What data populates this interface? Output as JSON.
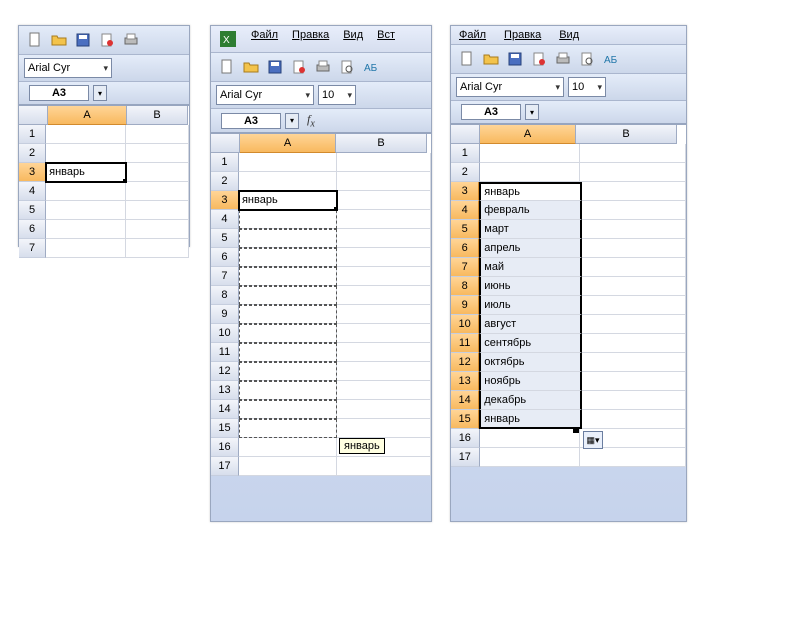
{
  "menus": {
    "file": "Файл",
    "edit": "Правка",
    "view": "Вид",
    "ins": "Вст"
  },
  "font": {
    "name": "Arial Cyr",
    "size": "10"
  },
  "namebox": "A3",
  "columns": {
    "A": "A",
    "B": "B"
  },
  "p1": {
    "rows": [
      1,
      2,
      3,
      4,
      5,
      6,
      7
    ]
  },
  "p2": {
    "rows": [
      1,
      2,
      3,
      4,
      5,
      6,
      7,
      8,
      9,
      10,
      11,
      12,
      13,
      14,
      15,
      16,
      17
    ],
    "tooltip": "январь"
  },
  "p3": {
    "rows": [
      1,
      2,
      3,
      4,
      5,
      6,
      7,
      8,
      9,
      10,
      11,
      12,
      13,
      14,
      15,
      16,
      17
    ]
  },
  "months": {
    "3": "январь",
    "4": "февраль",
    "5": "март",
    "6": "апрель",
    "7": "май",
    "8": "июнь",
    "9": "июль",
    "10": "август",
    "11": "сентябрь",
    "12": "октябрь",
    "13": "ноябрь",
    "14": "декабрь",
    "15": "январь"
  },
  "p1_a3": "январь",
  "p2_a3": "январь"
}
